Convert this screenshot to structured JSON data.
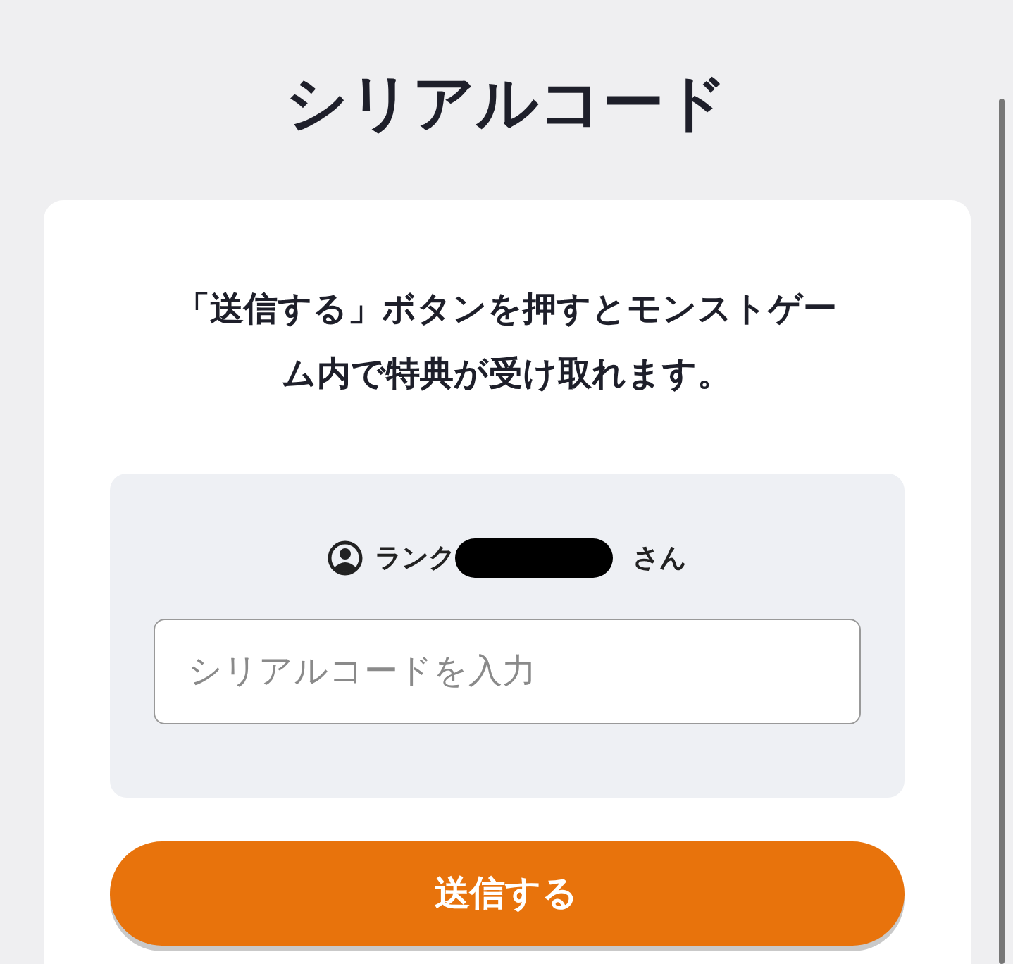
{
  "title": "シリアルコード",
  "message": "「送信する」ボタンを押すとモンストゲーム内で特典が受け取れます。",
  "user": {
    "prefix": "ランク",
    "suffix": "さん"
  },
  "serial_field": {
    "placeholder": "シリアルコードを入力"
  },
  "submit_button": "送信する"
}
